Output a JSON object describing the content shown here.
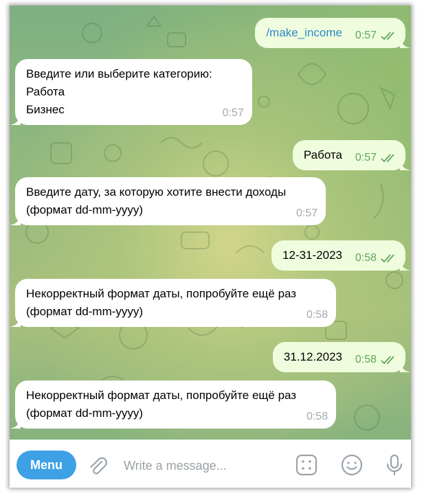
{
  "messages": [
    {
      "dir": "out",
      "text": "/make_income",
      "time": "0:57",
      "is_command": true
    },
    {
      "dir": "in",
      "lines": [
        "Введите или выберите категорию:",
        "Работа",
        "Бизнес"
      ],
      "time": "0:57"
    },
    {
      "dir": "out",
      "text": "Работа",
      "time": "0:57"
    },
    {
      "dir": "in",
      "lines": [
        "Введите дату, за которую хотите внести доходы",
        "(формат dd-mm-yyyy)"
      ],
      "time": "0:57"
    },
    {
      "dir": "out",
      "text": "12-31-2023",
      "time": "0:58"
    },
    {
      "dir": "in",
      "lines": [
        "Некорректный формат даты, попробуйте ещё раз",
        "(формат dd-mm-yyyy)"
      ],
      "time": "0:58"
    },
    {
      "dir": "out",
      "text": "31.12.2023",
      "time": "0:58"
    },
    {
      "dir": "in",
      "lines": [
        "Некорректный формат даты, попробуйте ещё раз",
        "(формат dd-mm-yyyy)"
      ],
      "time": "0:58"
    }
  ],
  "composer": {
    "menu_label": "Menu",
    "placeholder": "Write a message..."
  },
  "colors": {
    "incoming_bubble": "#ffffff",
    "outgoing_bubble": "#effdde",
    "outgoing_time": "#5fa45c",
    "command_link": "#2e89c8",
    "menu_button": "#3ea1e5"
  }
}
